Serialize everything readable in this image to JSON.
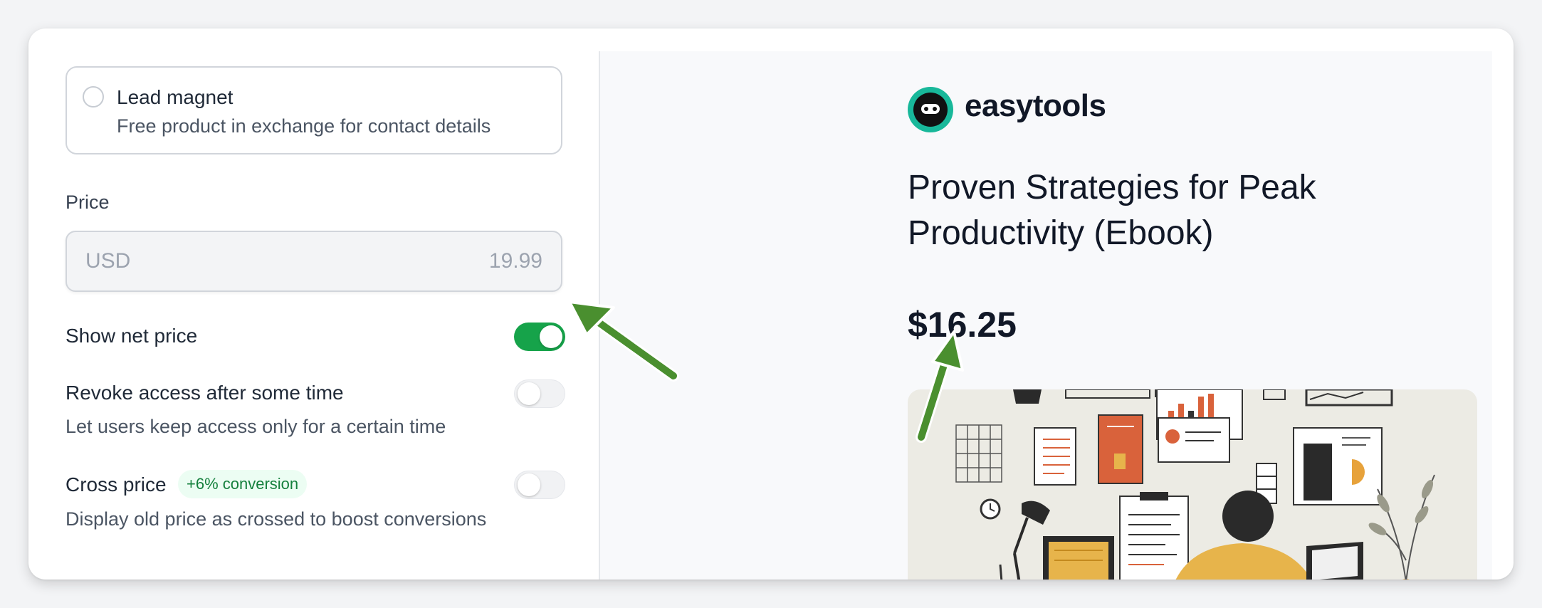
{
  "lead_magnet": {
    "title": "Lead magnet",
    "description": "Free product in exchange for contact details"
  },
  "price": {
    "label": "Price",
    "currency": "USD",
    "amount": "19.99"
  },
  "settings": {
    "show_net_price": {
      "label": "Show net price",
      "enabled": true
    },
    "revoke_access": {
      "label": "Revoke access after some time",
      "description": "Let users keep access only for a certain time",
      "enabled": false
    },
    "cross_price": {
      "label": "Cross price",
      "badge": "+6% conversion",
      "description": "Display old price as crossed to boost conversions",
      "enabled": false
    }
  },
  "preview": {
    "brand": "easytools",
    "product_title": "Proven Strategies for Peak Productivity (Ebook)",
    "net_price": "$16.25"
  },
  "colors": {
    "accent_green": "#16a34a",
    "arrow_green": "#4a8f2f",
    "logo_teal": "#18b89a"
  }
}
